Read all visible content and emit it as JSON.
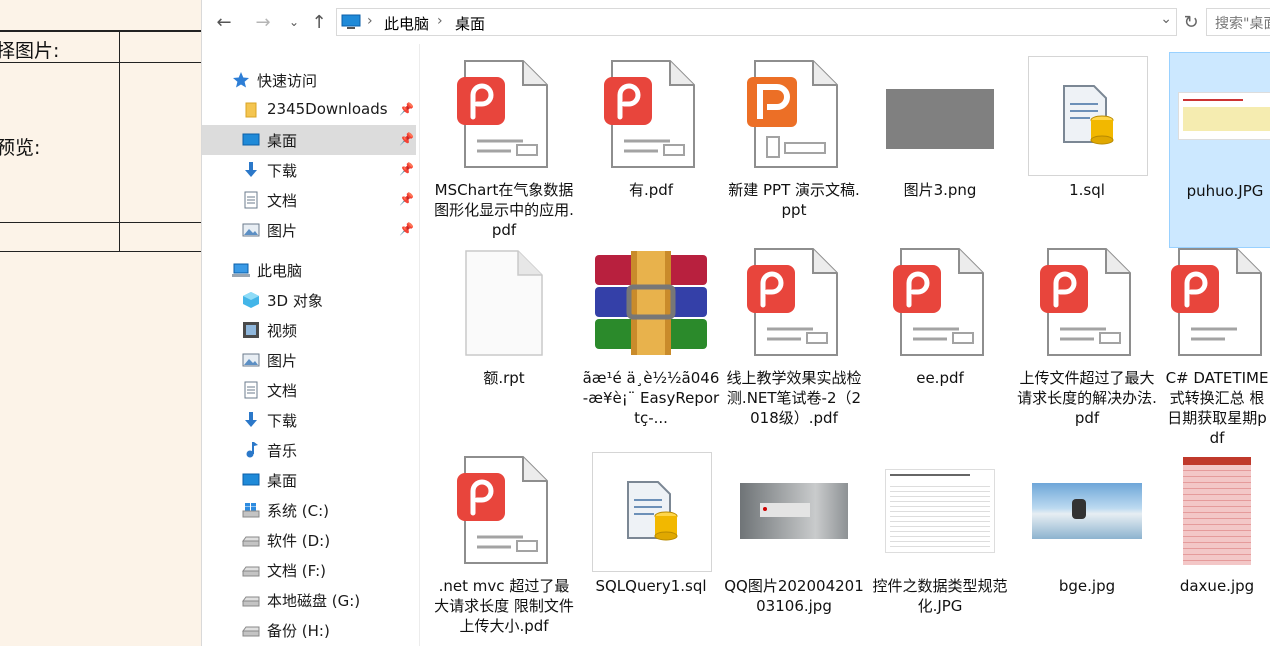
{
  "background_form": {
    "label_top": "择图片:",
    "label_mid": "预览:"
  },
  "toolbar": {
    "back_icon": "back-arrow-icon",
    "forward_icon": "forward-arrow-icon",
    "recent_icon": "chevron-down-icon",
    "up_icon": "up-arrow-icon"
  },
  "address": {
    "segments": [
      "此电脑",
      "桌面"
    ]
  },
  "search": {
    "placeholder": "搜索\"桌面"
  },
  "nav_pane": {
    "quick_access": "快速访问",
    "quick_items": [
      {
        "label": "2345Downloads",
        "icon": "folder-icon",
        "pinned": true
      },
      {
        "label": "桌面",
        "icon": "desktop-icon",
        "pinned": true,
        "selected": true
      },
      {
        "label": "下载",
        "icon": "download-icon",
        "pinned": true
      },
      {
        "label": "文档",
        "icon": "document-icon",
        "pinned": true
      },
      {
        "label": "图片",
        "icon": "pictures-icon",
        "pinned": true
      }
    ],
    "this_pc": "此电脑",
    "pc_items": [
      {
        "label": "3D 对象",
        "icon": "3d-objects-icon"
      },
      {
        "label": "视频",
        "icon": "video-icon"
      },
      {
        "label": "图片",
        "icon": "pictures-icon"
      },
      {
        "label": "文档",
        "icon": "document-icon"
      },
      {
        "label": "下载",
        "icon": "download-icon"
      },
      {
        "label": "音乐",
        "icon": "music-icon"
      },
      {
        "label": "桌面",
        "icon": "desktop-icon"
      },
      {
        "label": "系统 (C:)",
        "icon": "windows-drive-icon"
      },
      {
        "label": "软件 (D:)",
        "icon": "drive-icon"
      },
      {
        "label": "文档 (F:)",
        "icon": "drive-icon"
      },
      {
        "label": "本地磁盘 (G:)",
        "icon": "drive-icon"
      },
      {
        "label": "备份 (H:)",
        "icon": "drive-icon"
      }
    ]
  },
  "files": [
    {
      "label": "MSChart在气象数据图形化显示中的应用.pdf",
      "type": "pdf"
    },
    {
      "label": "有.pdf",
      "type": "pdf"
    },
    {
      "label": "新建 PPT 演示文稿.ppt",
      "type": "ppt"
    },
    {
      "label": "图片3.png",
      "type": "gray-image"
    },
    {
      "label": "1.sql",
      "type": "sql"
    },
    {
      "label": "puhuo.JPG",
      "type": "screenshot",
      "selected": true
    },
    {
      "label": "额.rpt",
      "type": "blank"
    },
    {
      "label": "ãæ¹é ä¸è½½ã046-æ¥è¡¨ EasyReportç-...",
      "type": "winrar"
    },
    {
      "label": "线上教学效果实战检测.NET笔试卷-2（2018级）.pdf",
      "type": "pdf"
    },
    {
      "label": "ee.pdf",
      "type": "pdf"
    },
    {
      "label": "上传文件超过了最大请求长度的解决办法.pdf",
      "type": "pdf"
    },
    {
      "label": "C# DATETIME式转换汇总 根日期获取星期pdf",
      "type": "pdf"
    },
    {
      "label": ".net mvc 超过了最大请求长度 限制文件上传大小.pdf",
      "type": "pdf"
    },
    {
      "label": "SQLQuery1.sql",
      "type": "sql"
    },
    {
      "label": "QQ图片20200420103106.jpg",
      "type": "photo-dark"
    },
    {
      "label": "控件之数据类型规范化.JPG",
      "type": "doc-screenshot"
    },
    {
      "label": "bge.jpg",
      "type": "anime"
    },
    {
      "label": "daxue.jpg",
      "type": "red-table"
    }
  ]
}
